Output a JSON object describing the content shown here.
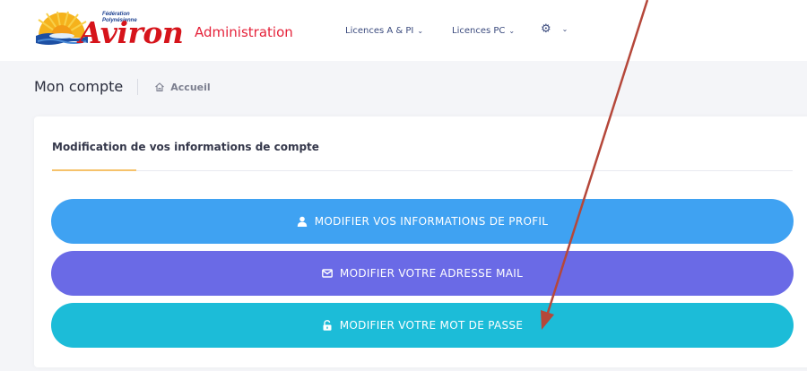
{
  "brand": {
    "logo_word": "Aviron",
    "logo_tagline": "Fédération Polynésienne",
    "app_title": "Administration"
  },
  "nav": {
    "items": [
      {
        "label": "Licences A & PI"
      },
      {
        "label": "Licences PC"
      }
    ]
  },
  "page": {
    "title": "Mon compte",
    "breadcrumb": "Accueil"
  },
  "card": {
    "tab_title": "Modification de vos informations de compte",
    "buttons": [
      {
        "label": "MODIFIER VOS INFORMATIONS DE PROFIL",
        "color": "#3fa2f2",
        "icon": "user-icon"
      },
      {
        "label": "MODIFIER VOTRE ADRESSE MAIL",
        "color": "#6a6ae6",
        "icon": "envelope-icon"
      },
      {
        "label": "MODIFIER VOTRE MOT DE PASSE",
        "color": "#1cbcd8",
        "icon": "unlock-icon"
      }
    ]
  },
  "colors": {
    "brand_red": "#e5223a",
    "nav_text": "#3a4a7d",
    "tab_accent": "#f6c26b",
    "annotation_arrow": "#b5473a"
  }
}
